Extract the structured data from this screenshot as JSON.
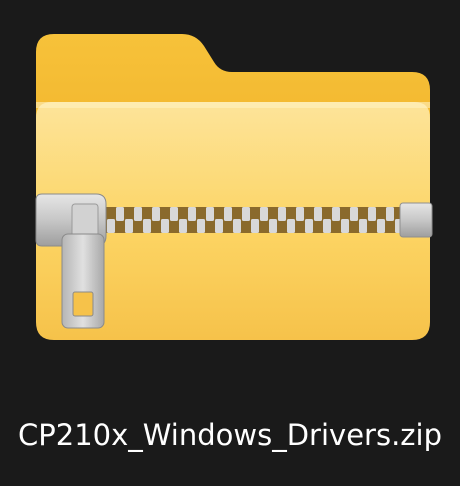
{
  "desktop": {
    "item": {
      "icon": "zip-folder-icon",
      "filename": "CP210x_Windows_Drivers.zip"
    }
  },
  "colors": {
    "background": "#1a1a1a",
    "folder_back": "#f2b429",
    "folder_front": "#fcd463",
    "zipper_metal": "#bdbdbd",
    "zipper_teeth": "#9a7a3a",
    "label_text": "#ffffff"
  }
}
